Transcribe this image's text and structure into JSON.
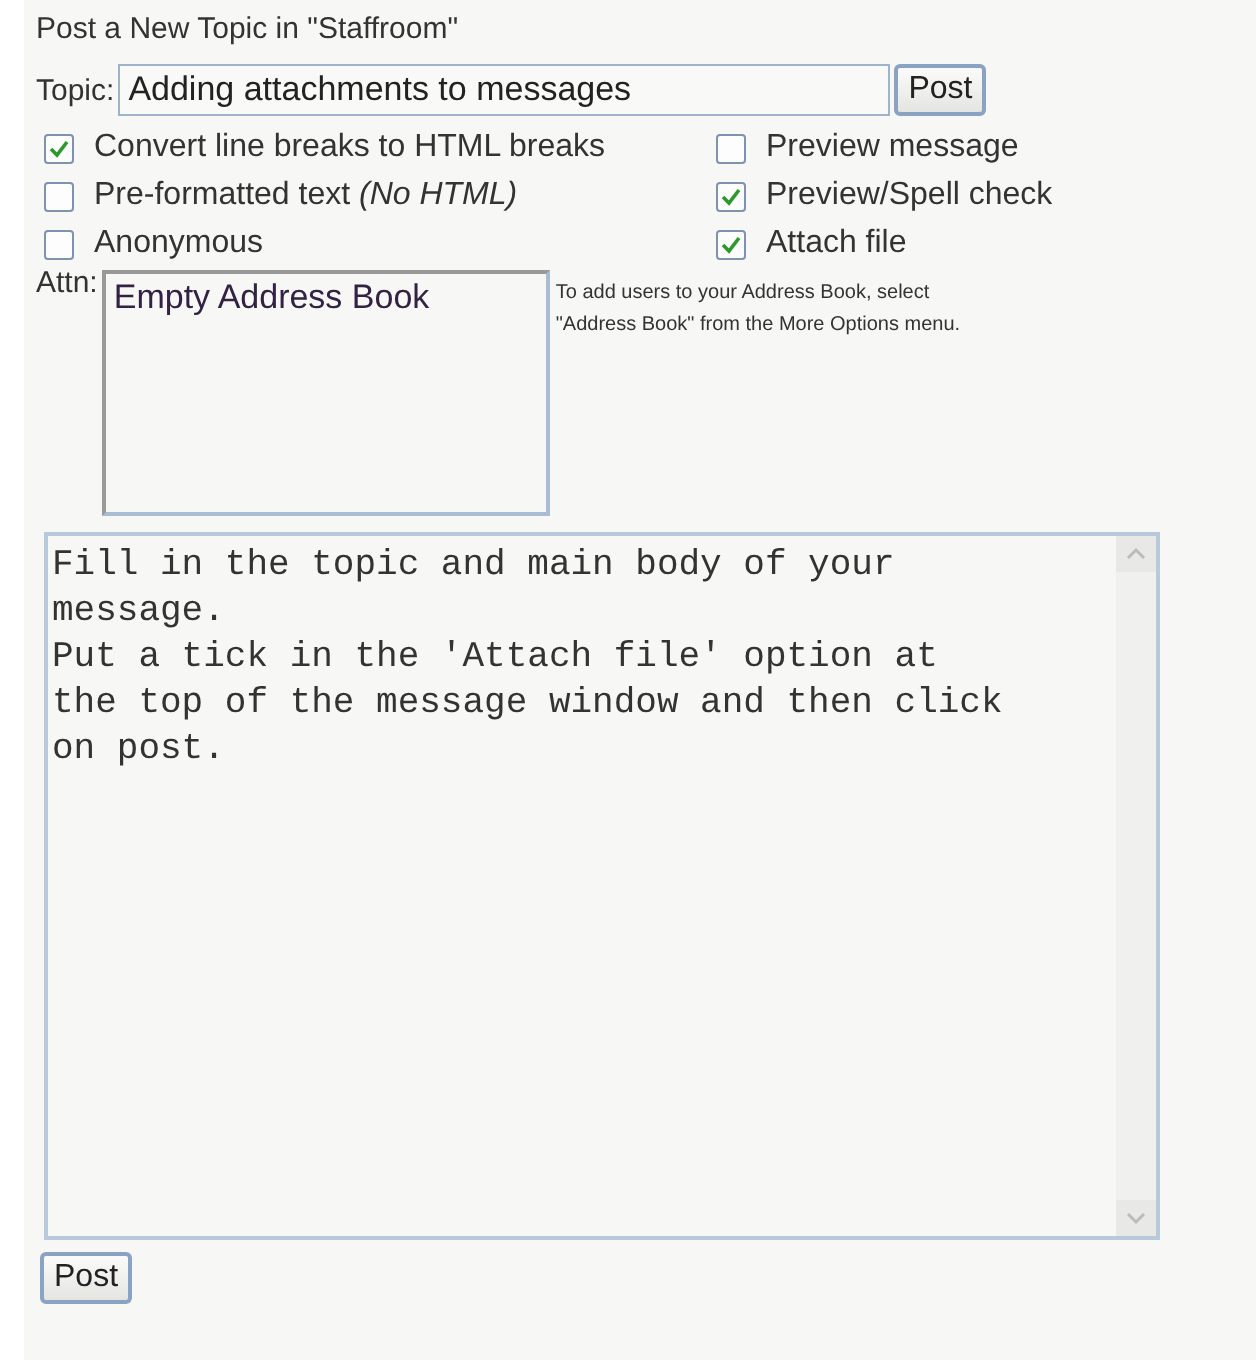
{
  "heading": "Post a New Topic in \"Staffroom\"",
  "topic": {
    "label": "Topic:",
    "value": "Adding attachments to messages",
    "button": "Post"
  },
  "options": [
    {
      "label": "Convert line breaks to HTML breaks",
      "checked": true
    },
    {
      "label": "Preview message",
      "checked": false
    },
    {
      "label": "Pre-formatted text *(No HTML)*",
      "checked": false
    },
    {
      "label": "Preview/Spell check",
      "checked": true
    },
    {
      "label": "Anonymous",
      "checked": false
    },
    {
      "label": "Attach file",
      "checked": true
    }
  ],
  "attn": {
    "label": "Attn:",
    "items": [
      "Empty Address Book"
    ],
    "help": "To add users to your Address Book, select \"Address Book\" from the More Options menu."
  },
  "message": {
    "value": "Fill in the topic and main body of your message.\nPut a tick in the 'Attach file' option at the top of the message window and then click on post."
  },
  "submit": "Post"
}
